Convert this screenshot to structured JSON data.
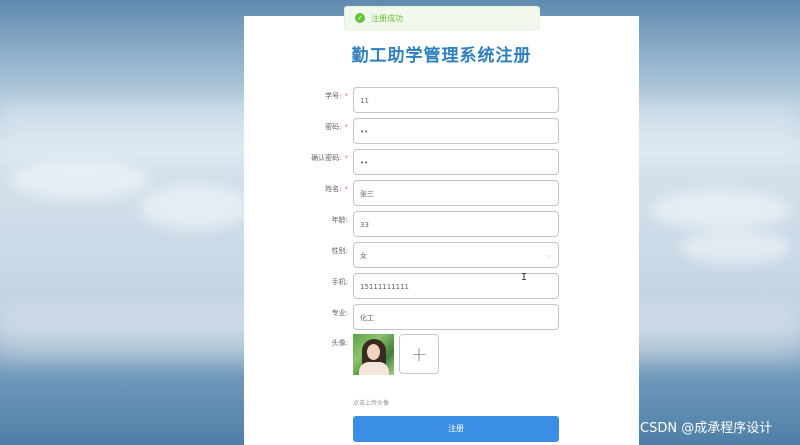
{
  "toast": {
    "icon": "check-circle-icon",
    "message": "注册成功"
  },
  "page": {
    "title": "勤工助学管理系统注册"
  },
  "form": {
    "fields": [
      {
        "label": "学号:",
        "required": true,
        "value": "11"
      },
      {
        "label": "密码:",
        "required": true,
        "value": "••"
      },
      {
        "label": "确认密码:",
        "required": true,
        "value": "••"
      },
      {
        "label": "姓名:",
        "required": true,
        "value": "张三"
      },
      {
        "label": "年龄:",
        "required": false,
        "value": "33"
      },
      {
        "label": "性别:",
        "required": false,
        "value": "女"
      },
      {
        "label": "手机:",
        "required": false,
        "value": "15111111111"
      },
      {
        "label": "专业:",
        "required": false,
        "value": "化工"
      }
    ],
    "avatar_label": "头像:",
    "upload_plus": "+",
    "upload_hint": "点击上传头像",
    "submit_label": "注册",
    "required_mark": "*",
    "select_chevron": "⌵"
  },
  "cursor": "I",
  "watermark": "CSDN @成承程序设计",
  "colors": {
    "accent": "#3a8ee6",
    "title": "#2f7fbf",
    "success": "#67c23a",
    "required": "#f56c6c"
  }
}
